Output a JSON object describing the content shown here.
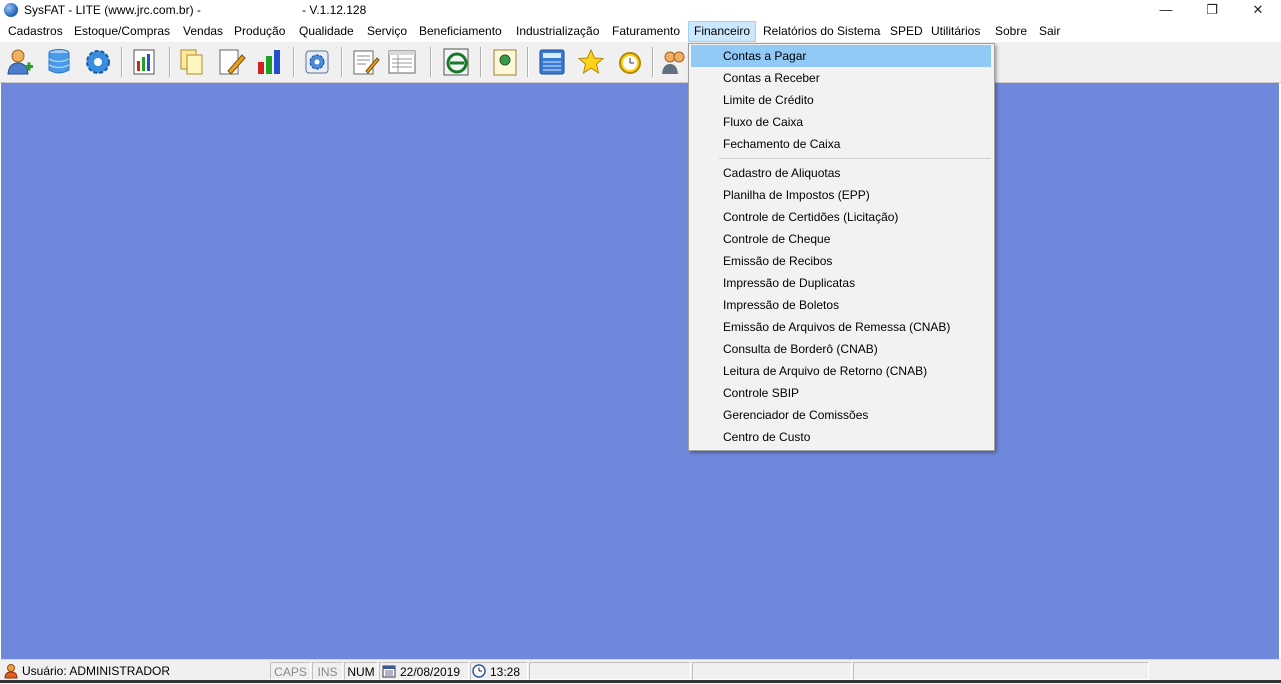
{
  "window": {
    "title": "SysFAT - LITE (www.jrc.com.br) -",
    "version": "- V.1.12.128",
    "min_glyph": "—",
    "max_glyph": "❐",
    "close_glyph": "✕"
  },
  "menubar": {
    "items": [
      "Cadastros",
      "Estoque/Compras",
      "Vendas",
      "Produção",
      "Qualidade",
      "Serviço",
      "Beneficiamento",
      "Industrialização",
      "Faturamento",
      "Financeiro",
      "Relatórios do Sistema",
      "SPED",
      "Utilitários",
      "Sobre",
      "Sair"
    ],
    "active": "Financeiro"
  },
  "toolbar": {
    "icons": [
      "add-user-icon",
      "database-icon",
      "gear-icon",
      "report-icon",
      "copy-documents-icon",
      "edit-document-icon",
      "bar-chart-icon",
      "settings-disc-icon",
      "notepad-icon",
      "list-form-icon",
      "nfe-icon",
      "document-globe-icon",
      "calculator-icon",
      "star-icon",
      "alarm-clock-icon",
      "users-icon"
    ]
  },
  "financeiro_menu": {
    "group1": [
      "Contas a Pagar",
      "Contas a Receber",
      "Limite de Crédito",
      "Fluxo de Caixa",
      "Fechamento de Caixa"
    ],
    "group2": [
      "Cadastro de Aliquotas",
      "Planilha de Impostos (EPP)",
      "Controle de Certidões (Licitação)",
      "Controle de Cheque",
      "Emissão de Recibos",
      "Impressão de Duplicatas",
      "Impressão de Boletos",
      "Emissão de Arquivos de Remessa (CNAB)",
      "Consulta de Borderô (CNAB)",
      "Leitura de Arquivo de Retorno (CNAB)",
      "Controle SBIP",
      "Gerenciador de Comissões",
      "Centro de Custo"
    ],
    "highlighted": "Contas a Pagar"
  },
  "statusbar": {
    "user": "Usuário: ADMINISTRADOR",
    "caps": "CAPS",
    "ins": "INS",
    "num": "NUM",
    "date": "22/08/2019",
    "time": "13:28"
  },
  "colors": {
    "desktop": "#6f88db",
    "menu_highlight": "#91c9f7"
  }
}
